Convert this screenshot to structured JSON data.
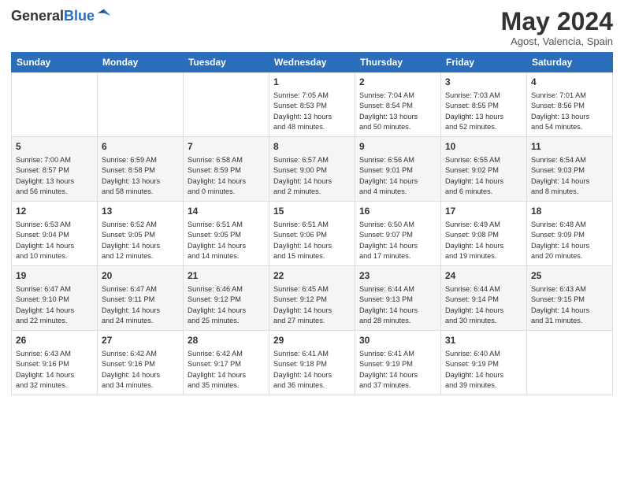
{
  "header": {
    "logo_general": "General",
    "logo_blue": "Blue",
    "month_title": "May 2024",
    "location": "Agost, Valencia, Spain"
  },
  "days_of_week": [
    "Sunday",
    "Monday",
    "Tuesday",
    "Wednesday",
    "Thursday",
    "Friday",
    "Saturday"
  ],
  "weeks": [
    [
      {
        "day": "",
        "info": ""
      },
      {
        "day": "",
        "info": ""
      },
      {
        "day": "",
        "info": ""
      },
      {
        "day": "1",
        "info": "Sunrise: 7:05 AM\nSunset: 8:53 PM\nDaylight: 13 hours\nand 48 minutes."
      },
      {
        "day": "2",
        "info": "Sunrise: 7:04 AM\nSunset: 8:54 PM\nDaylight: 13 hours\nand 50 minutes."
      },
      {
        "day": "3",
        "info": "Sunrise: 7:03 AM\nSunset: 8:55 PM\nDaylight: 13 hours\nand 52 minutes."
      },
      {
        "day": "4",
        "info": "Sunrise: 7:01 AM\nSunset: 8:56 PM\nDaylight: 13 hours\nand 54 minutes."
      }
    ],
    [
      {
        "day": "5",
        "info": "Sunrise: 7:00 AM\nSunset: 8:57 PM\nDaylight: 13 hours\nand 56 minutes."
      },
      {
        "day": "6",
        "info": "Sunrise: 6:59 AM\nSunset: 8:58 PM\nDaylight: 13 hours\nand 58 minutes."
      },
      {
        "day": "7",
        "info": "Sunrise: 6:58 AM\nSunset: 8:59 PM\nDaylight: 14 hours\nand 0 minutes."
      },
      {
        "day": "8",
        "info": "Sunrise: 6:57 AM\nSunset: 9:00 PM\nDaylight: 14 hours\nand 2 minutes."
      },
      {
        "day": "9",
        "info": "Sunrise: 6:56 AM\nSunset: 9:01 PM\nDaylight: 14 hours\nand 4 minutes."
      },
      {
        "day": "10",
        "info": "Sunrise: 6:55 AM\nSunset: 9:02 PM\nDaylight: 14 hours\nand 6 minutes."
      },
      {
        "day": "11",
        "info": "Sunrise: 6:54 AM\nSunset: 9:03 PM\nDaylight: 14 hours\nand 8 minutes."
      }
    ],
    [
      {
        "day": "12",
        "info": "Sunrise: 6:53 AM\nSunset: 9:04 PM\nDaylight: 14 hours\nand 10 minutes."
      },
      {
        "day": "13",
        "info": "Sunrise: 6:52 AM\nSunset: 9:05 PM\nDaylight: 14 hours\nand 12 minutes."
      },
      {
        "day": "14",
        "info": "Sunrise: 6:51 AM\nSunset: 9:05 PM\nDaylight: 14 hours\nand 14 minutes."
      },
      {
        "day": "15",
        "info": "Sunrise: 6:51 AM\nSunset: 9:06 PM\nDaylight: 14 hours\nand 15 minutes."
      },
      {
        "day": "16",
        "info": "Sunrise: 6:50 AM\nSunset: 9:07 PM\nDaylight: 14 hours\nand 17 minutes."
      },
      {
        "day": "17",
        "info": "Sunrise: 6:49 AM\nSunset: 9:08 PM\nDaylight: 14 hours\nand 19 minutes."
      },
      {
        "day": "18",
        "info": "Sunrise: 6:48 AM\nSunset: 9:09 PM\nDaylight: 14 hours\nand 20 minutes."
      }
    ],
    [
      {
        "day": "19",
        "info": "Sunrise: 6:47 AM\nSunset: 9:10 PM\nDaylight: 14 hours\nand 22 minutes."
      },
      {
        "day": "20",
        "info": "Sunrise: 6:47 AM\nSunset: 9:11 PM\nDaylight: 14 hours\nand 24 minutes."
      },
      {
        "day": "21",
        "info": "Sunrise: 6:46 AM\nSunset: 9:12 PM\nDaylight: 14 hours\nand 25 minutes."
      },
      {
        "day": "22",
        "info": "Sunrise: 6:45 AM\nSunset: 9:12 PM\nDaylight: 14 hours\nand 27 minutes."
      },
      {
        "day": "23",
        "info": "Sunrise: 6:44 AM\nSunset: 9:13 PM\nDaylight: 14 hours\nand 28 minutes."
      },
      {
        "day": "24",
        "info": "Sunrise: 6:44 AM\nSunset: 9:14 PM\nDaylight: 14 hours\nand 30 minutes."
      },
      {
        "day": "25",
        "info": "Sunrise: 6:43 AM\nSunset: 9:15 PM\nDaylight: 14 hours\nand 31 minutes."
      }
    ],
    [
      {
        "day": "26",
        "info": "Sunrise: 6:43 AM\nSunset: 9:16 PM\nDaylight: 14 hours\nand 32 minutes."
      },
      {
        "day": "27",
        "info": "Sunrise: 6:42 AM\nSunset: 9:16 PM\nDaylight: 14 hours\nand 34 minutes."
      },
      {
        "day": "28",
        "info": "Sunrise: 6:42 AM\nSunset: 9:17 PM\nDaylight: 14 hours\nand 35 minutes."
      },
      {
        "day": "29",
        "info": "Sunrise: 6:41 AM\nSunset: 9:18 PM\nDaylight: 14 hours\nand 36 minutes."
      },
      {
        "day": "30",
        "info": "Sunrise: 6:41 AM\nSunset: 9:19 PM\nDaylight: 14 hours\nand 37 minutes."
      },
      {
        "day": "31",
        "info": "Sunrise: 6:40 AM\nSunset: 9:19 PM\nDaylight: 14 hours\nand 39 minutes."
      },
      {
        "day": "",
        "info": ""
      }
    ]
  ]
}
